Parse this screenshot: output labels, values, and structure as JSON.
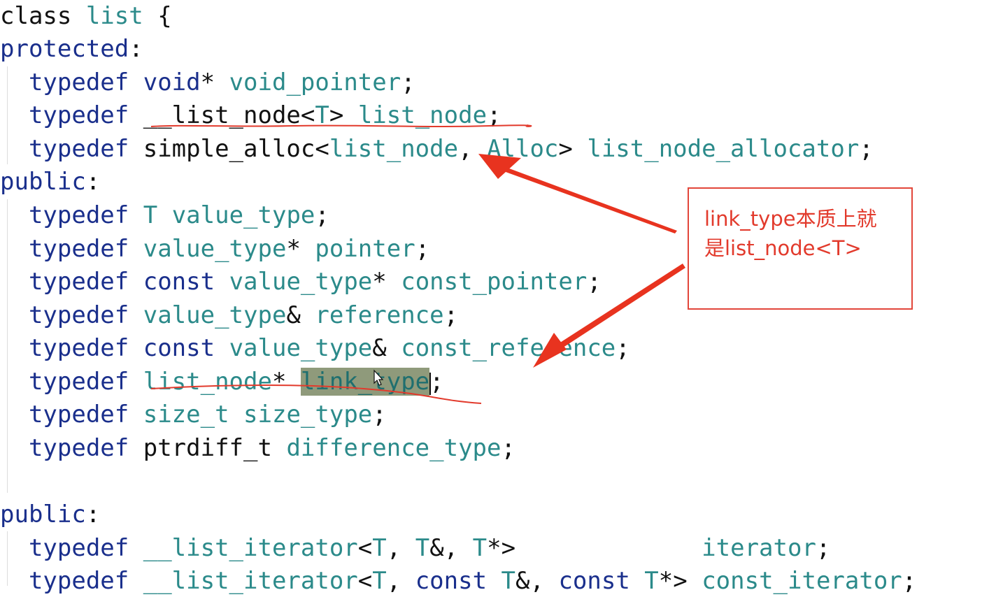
{
  "code": {
    "lines": [
      [
        {
          "t": "class ",
          "c": "pl"
        },
        {
          "t": "list",
          "c": "ty"
        },
        {
          "t": " {",
          "c": "pl"
        }
      ],
      [
        {
          "t": "protected",
          "c": "kw"
        },
        {
          "t": ":",
          "c": "pl"
        }
      ],
      [
        {
          "t": "  "
        },
        {
          "t": "typedef",
          "c": "kw"
        },
        {
          "t": " "
        },
        {
          "t": "void",
          "c": "kw"
        },
        {
          "t": "* ",
          "c": "pl"
        },
        {
          "t": "void_pointer",
          "c": "ty"
        },
        {
          "t": ";",
          "c": "pl"
        }
      ],
      [
        {
          "t": "  "
        },
        {
          "t": "typedef",
          "c": "kw"
        },
        {
          "t": " "
        },
        {
          "t": "__list_node",
          "c": "pl"
        },
        {
          "t": "<",
          "c": "pl"
        },
        {
          "t": "T",
          "c": "ty"
        },
        {
          "t": "> ",
          "c": "pl"
        },
        {
          "t": "list_node",
          "c": "ty"
        },
        {
          "t": ";",
          "c": "pl"
        }
      ],
      [
        {
          "t": "  "
        },
        {
          "t": "typedef",
          "c": "kw"
        },
        {
          "t": " "
        },
        {
          "t": "simple_alloc",
          "c": "pl"
        },
        {
          "t": "<",
          "c": "pl"
        },
        {
          "t": "list_node",
          "c": "ty"
        },
        {
          "t": ", ",
          "c": "pl"
        },
        {
          "t": "Alloc",
          "c": "ty"
        },
        {
          "t": "> ",
          "c": "pl"
        },
        {
          "t": "list_node_allocator",
          "c": "ty"
        },
        {
          "t": ";",
          "c": "pl"
        }
      ],
      [
        {
          "t": "public",
          "c": "kw"
        },
        {
          "t": ":",
          "c": "pl"
        }
      ],
      [
        {
          "t": "  "
        },
        {
          "t": "typedef",
          "c": "kw"
        },
        {
          "t": " "
        },
        {
          "t": "T",
          "c": "ty"
        },
        {
          "t": " "
        },
        {
          "t": "value_type",
          "c": "ty"
        },
        {
          "t": ";",
          "c": "pl"
        }
      ],
      [
        {
          "t": "  "
        },
        {
          "t": "typedef",
          "c": "kw"
        },
        {
          "t": " "
        },
        {
          "t": "value_type",
          "c": "ty"
        },
        {
          "t": "* ",
          "c": "pl"
        },
        {
          "t": "pointer",
          "c": "ty"
        },
        {
          "t": ";",
          "c": "pl"
        }
      ],
      [
        {
          "t": "  "
        },
        {
          "t": "typedef",
          "c": "kw"
        },
        {
          "t": " "
        },
        {
          "t": "const",
          "c": "kw"
        },
        {
          "t": " "
        },
        {
          "t": "value_type",
          "c": "ty"
        },
        {
          "t": "* ",
          "c": "pl"
        },
        {
          "t": "const_pointer",
          "c": "ty"
        },
        {
          "t": ";",
          "c": "pl"
        }
      ],
      [
        {
          "t": "  "
        },
        {
          "t": "typedef",
          "c": "kw"
        },
        {
          "t": " "
        },
        {
          "t": "value_type",
          "c": "ty"
        },
        {
          "t": "& ",
          "c": "pl"
        },
        {
          "t": "reference",
          "c": "ty"
        },
        {
          "t": ";",
          "c": "pl"
        }
      ],
      [
        {
          "t": "  "
        },
        {
          "t": "typedef",
          "c": "kw"
        },
        {
          "t": " "
        },
        {
          "t": "const",
          "c": "kw"
        },
        {
          "t": " "
        },
        {
          "t": "value_type",
          "c": "ty"
        },
        {
          "t": "& ",
          "c": "pl"
        },
        {
          "t": "const_reference",
          "c": "ty"
        },
        {
          "t": ";",
          "c": "pl"
        }
      ],
      [
        {
          "t": "  "
        },
        {
          "t": "typedef",
          "c": "kw"
        },
        {
          "t": " "
        },
        {
          "t": "list_node",
          "c": "ty"
        },
        {
          "t": "* ",
          "c": "pl"
        },
        {
          "t": "link_type",
          "c": "hl"
        },
        {
          "t": ";",
          "c": "pl"
        }
      ],
      [
        {
          "t": "  "
        },
        {
          "t": "typedef",
          "c": "kw"
        },
        {
          "t": " "
        },
        {
          "t": "size_t",
          "c": "ty"
        },
        {
          "t": " "
        },
        {
          "t": "size_type",
          "c": "ty"
        },
        {
          "t": ";",
          "c": "pl"
        }
      ],
      [
        {
          "t": "  "
        },
        {
          "t": "typedef",
          "c": "kw"
        },
        {
          "t": " "
        },
        {
          "t": "ptrdiff_t",
          "c": "pl"
        },
        {
          "t": " "
        },
        {
          "t": "difference_type",
          "c": "ty"
        },
        {
          "t": ";",
          "c": "pl"
        }
      ],
      [
        {
          "t": ""
        }
      ],
      [
        {
          "t": "public",
          "c": "kw"
        },
        {
          "t": ":",
          "c": "pl"
        }
      ],
      [
        {
          "t": "  "
        },
        {
          "t": "typedef",
          "c": "kw"
        },
        {
          "t": " "
        },
        {
          "t": "__list_iterator",
          "c": "ty"
        },
        {
          "t": "<",
          "c": "pl"
        },
        {
          "t": "T",
          "c": "ty"
        },
        {
          "t": ", ",
          "c": "pl"
        },
        {
          "t": "T",
          "c": "ty"
        },
        {
          "t": "&, ",
          "c": "pl"
        },
        {
          "t": "T",
          "c": "ty"
        },
        {
          "t": "*>",
          "c": "pl"
        },
        {
          "t": "             "
        },
        {
          "t": "iterator",
          "c": "ty"
        },
        {
          "t": ";",
          "c": "pl"
        }
      ],
      [
        {
          "t": "  "
        },
        {
          "t": "typedef",
          "c": "kw"
        },
        {
          "t": " "
        },
        {
          "t": "__list_iterator",
          "c": "ty"
        },
        {
          "t": "<",
          "c": "pl"
        },
        {
          "t": "T",
          "c": "ty"
        },
        {
          "t": ", ",
          "c": "pl"
        },
        {
          "t": "const",
          "c": "kw"
        },
        {
          "t": " "
        },
        {
          "t": "T",
          "c": "ty"
        },
        {
          "t": "&, ",
          "c": "pl"
        },
        {
          "t": "const",
          "c": "kw"
        },
        {
          "t": " "
        },
        {
          "t": "T",
          "c": "ty"
        },
        {
          "t": "*> ",
          "c": "pl"
        },
        {
          "t": "const_iterator",
          "c": "ty"
        },
        {
          "t": ";",
          "c": "pl"
        }
      ]
    ]
  },
  "annotation": {
    "text_line1": "link_type本质上就",
    "text_line2": "是list_node<T>"
  },
  "colors": {
    "keyword": "#1a2f8c",
    "type": "#2b8a8a",
    "plain": "#111111",
    "highlight": "#8f9a7b",
    "annotation_red": "#e23a2c"
  },
  "icons": {
    "cursor": "mouse-pointer-icon",
    "arrow": "red-arrow-icon"
  }
}
